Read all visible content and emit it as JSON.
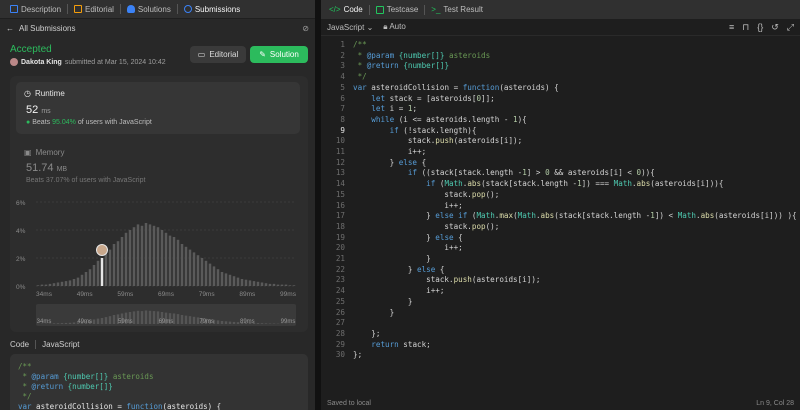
{
  "left_tabs": [
    {
      "label": "Description",
      "icon": "description-icon",
      "color": "#3b82f6"
    },
    {
      "label": "Editorial",
      "icon": "editorial-icon",
      "color": "#f59e0b"
    },
    {
      "label": "Solutions",
      "icon": "solutions-icon",
      "color": "#3b82f6"
    },
    {
      "label": "Submissions",
      "icon": "submissions-icon",
      "color": "#3b82f6"
    }
  ],
  "back_label": "All Submissions",
  "status": "Accepted",
  "author": {
    "name": "Dakota King",
    "submitted": "submitted at Mar 15, 2024 10:42"
  },
  "buttons": {
    "editorial": "Editorial",
    "solution": "Solution"
  },
  "runtime": {
    "title": "Runtime",
    "value": "52",
    "unit": "ms",
    "beats_prefix": "Beats",
    "beats_pct": "95.04%",
    "beats_suffix": "of users with JavaScript"
  },
  "memory": {
    "title": "Memory",
    "value": "51.74",
    "unit": "MB",
    "beats_text": "Beats 37.07% of users with JavaScript"
  },
  "chart_data": {
    "type": "bar",
    "y_ticks": [
      "6%",
      "4%",
      "2%",
      "0%"
    ],
    "ylim": [
      0,
      6
    ],
    "x_ticks": [
      "34ms",
      "49ms",
      "59ms",
      "69ms",
      "79ms",
      "89ms",
      "99ms"
    ],
    "overview_ticks": [
      "34ms",
      "49ms",
      "59ms",
      "69ms",
      "79ms",
      "89ms",
      "99ms"
    ],
    "user_bar_index": 16,
    "values": [
      0.05,
      0.1,
      0.1,
      0.15,
      0.2,
      0.25,
      0.3,
      0.35,
      0.4,
      0.5,
      0.6,
      0.8,
      1.0,
      1.2,
      1.5,
      1.8,
      2.0,
      2.3,
      2.6,
      3.0,
      3.2,
      3.5,
      3.8,
      4.0,
      4.2,
      4.4,
      4.3,
      4.5,
      4.4,
      4.3,
      4.2,
      4.0,
      3.8,
      3.6,
      3.5,
      3.3,
      3.0,
      2.8,
      2.6,
      2.4,
      2.2,
      2.0,
      1.8,
      1.6,
      1.4,
      1.2,
      1.0,
      0.9,
      0.8,
      0.7,
      0.6,
      0.5,
      0.45,
      0.4,
      0.35,
      0.3,
      0.25,
      0.2,
      0.15,
      0.15,
      0.1,
      0.1,
      0.1,
      0.05,
      0.05
    ]
  },
  "code_section": {
    "title": "Code",
    "language": "JavaScript"
  },
  "code_preview": [
    "/**",
    " * @param {number[]} asteroids",
    " * @return {number[]}",
    " */",
    "var asteroidCollision = function(asteroids) {"
  ],
  "right_tabs": [
    {
      "label": "Code",
      "icon": "code-icon",
      "color": "#22c55e"
    },
    {
      "label": "Testcase",
      "icon": "testcase-icon",
      "color": "#22c55e"
    },
    {
      "label": "Test Result",
      "icon": "terminal-icon",
      "color": "#22c55e"
    }
  ],
  "toolbar": {
    "language": "JavaScript",
    "mode": "Auto"
  },
  "code_lines": [
    "/**",
    " * @param {number[]} asteroids",
    " * @return {number[]}",
    " */",
    "var asteroidCollision = function(asteroids) {",
    "    let stack = [asteroids[0]];",
    "    let i = 1;",
    "    while (i <= asteroids.length - 1){",
    "        if (!stack.length){",
    "            stack.push(asteroids[i]);",
    "            i++;",
    "        } else {",
    "            if ((stack[stack.length -1] > 0 && asteroids[i] < 0)){",
    "                if (Math.abs(stack[stack.length -1]) === Math.abs(asteroids[i])){",
    "                    stack.pop();",
    "                    i++;",
    "                } else if (Math.max(Math.abs(stack[stack.length -1]) < Math.abs(asteroids[i])) ){",
    "                    stack.pop();",
    "                } else {",
    "                    i++;",
    "                }",
    "            } else {",
    "                stack.push(asteroids[i]);",
    "                i++;",
    "            }",
    "        }",
    "",
    "    };",
    "    return stack;",
    "};"
  ],
  "current_line": 9,
  "status_bar": {
    "left": "Saved to local",
    "right": "Ln 9, Col 28"
  }
}
